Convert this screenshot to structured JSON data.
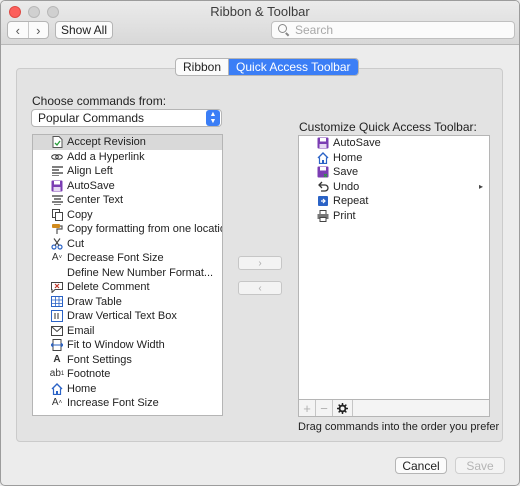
{
  "window": {
    "title": "Ribbon & Toolbar"
  },
  "toolbar": {
    "back_label": "‹",
    "forward_label": "›",
    "show_all_label": "Show All",
    "search_placeholder": "Search"
  },
  "tabs": [
    {
      "label": "Ribbon",
      "active": false
    },
    {
      "label": "Quick Access Toolbar",
      "active": true
    }
  ],
  "commands_from": {
    "label": "Choose commands from:",
    "selected": "Popular Commands"
  },
  "command_list": [
    {
      "label": "Accept Revision",
      "icon": "accept-revision-icon",
      "selected": true
    },
    {
      "label": "Add a Hyperlink",
      "icon": "hyperlink-icon"
    },
    {
      "label": "Align Left",
      "icon": "align-left-icon"
    },
    {
      "label": "AutoSave",
      "icon": "autosave-icon"
    },
    {
      "label": "Center Text",
      "icon": "center-text-icon"
    },
    {
      "label": "Copy",
      "icon": "copy-icon"
    },
    {
      "label": "Copy formatting from one location...",
      "icon": "format-painter-icon"
    },
    {
      "label": "Cut",
      "icon": "cut-icon"
    },
    {
      "label": "Decrease Font Size",
      "icon": "decrease-font-icon"
    },
    {
      "label": "Define New Number Format...",
      "icon": ""
    },
    {
      "label": "Delete Comment",
      "icon": "delete-comment-icon"
    },
    {
      "label": "Draw Table",
      "icon": "draw-table-icon"
    },
    {
      "label": "Draw Vertical Text Box",
      "icon": "vertical-textbox-icon"
    },
    {
      "label": "Email",
      "icon": "email-icon"
    },
    {
      "label": "Fit to Window Width",
      "icon": "fit-width-icon"
    },
    {
      "label": "Font Settings",
      "icon": "font-settings-icon"
    },
    {
      "label": "Footnote",
      "icon": "footnote-icon"
    },
    {
      "label": "Home",
      "icon": "home-icon"
    },
    {
      "label": "Increase Font Size",
      "icon": "increase-font-icon"
    }
  ],
  "move_buttons": {
    "add": "›",
    "remove": "‹"
  },
  "customize": {
    "label": "Customize Quick Access Toolbar:",
    "items": [
      {
        "label": "AutoSave",
        "icon": "autosave-icon"
      },
      {
        "label": "Home",
        "icon": "home-icon"
      },
      {
        "label": "Save",
        "icon": "save-icon"
      },
      {
        "label": "Undo",
        "icon": "undo-icon",
        "submenu": "▸"
      },
      {
        "label": "Repeat",
        "icon": "repeat-icon"
      },
      {
        "label": "Print",
        "icon": "print-icon"
      }
    ],
    "add_label": "+",
    "remove_label": "−",
    "hint": "Drag commands into the order you prefer"
  },
  "footer": {
    "cancel_label": "Cancel",
    "save_label": "Save"
  },
  "colors": {
    "accent": "#3b7ef6",
    "close_button": "#fc605c"
  }
}
